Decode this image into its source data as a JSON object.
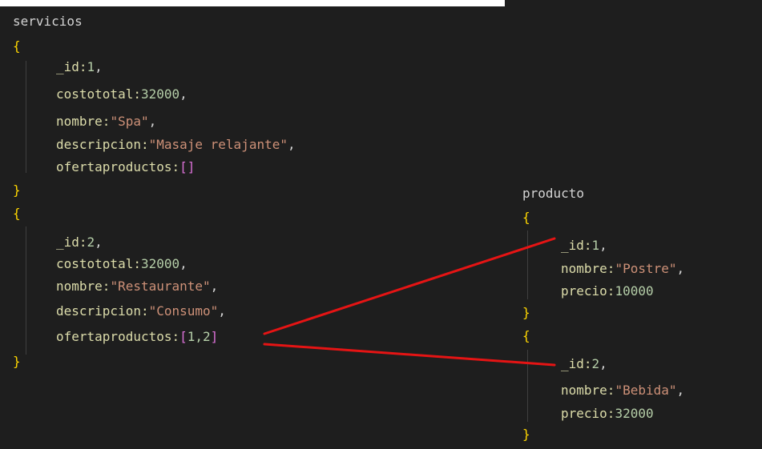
{
  "servicios": {
    "title": "servicios",
    "brace_open": "{",
    "brace_close": "}",
    "items": [
      {
        "id_key": "_id:",
        "id_value": "1",
        "costo_key": "costototal:",
        "costo_value": "32000",
        "nombre_key": "nombre:",
        "nombre_value": "\"Spa\"",
        "descripcion_key": "descripcion:",
        "descripcion_value": "\"Masaje relajante\"",
        "oferta_key": "ofertaproductos:",
        "oferta_value": "[]"
      },
      {
        "id_key": "_id:",
        "id_value": "2",
        "costo_key": "costototal:",
        "costo_value": "32000",
        "nombre_key": "nombre:",
        "nombre_value": "\"Restaurante\"",
        "descripcion_key": "descripcion:",
        "descripcion_value": "\"Consumo\"",
        "oferta_key": "ofertaproductos:",
        "oferta_open": "[",
        "oferta_value": "1,2",
        "oferta_close": "]"
      }
    ]
  },
  "producto": {
    "title": "producto",
    "brace_open": "{",
    "brace_close": "}",
    "items": [
      {
        "id_key": "_id:",
        "id_value": "1",
        "nombre_key": "nombre:",
        "nombre_value": "\"Postre\"",
        "precio_key": "precio:",
        "precio_value": "10000"
      },
      {
        "id_key": "_id:",
        "id_value": "2",
        "nombre_key": "nombre:",
        "nombre_value": "\"Bebida\"",
        "precio_key": "precio:",
        "precio_value": "32000"
      }
    ]
  },
  "punctuation": {
    "comma": ","
  },
  "colors": {
    "background": "#1e1e1e",
    "key": "#dcdcaa",
    "number": "#b5cea8",
    "string": "#ce9178",
    "brace": "#ffd700",
    "bracket": "#da70d6",
    "connector": "#e51414"
  }
}
